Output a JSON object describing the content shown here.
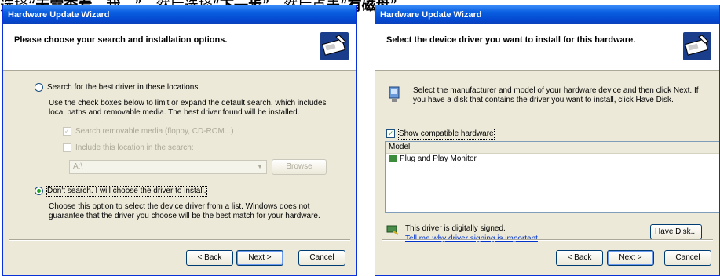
{
  "caption": {
    "pre": "选择“",
    "bold1": "无需查看。我…",
    "mid1": "”，然后选择“",
    "next": "下一步",
    "mid2": "”，然后点击“",
    "bold2": "有磁盘",
    "post": "”。"
  },
  "left_window": {
    "title": "Hardware Update Wizard",
    "header_title": "Please choose your search and installation options.",
    "radio_search_label": "Search for the best driver in these locations.",
    "search_desc": "Use the check boxes below to limit or expand the default search, which includes local paths and removable media. The best driver found will be installed.",
    "check_removable": "Search removable media (floppy, CD-ROM...)",
    "check_location": "Include this location in the search:",
    "location_value": "A:\\",
    "browse_label": "Browse",
    "radio_dont_label": "Don't search. I will choose the driver to install.",
    "dont_desc": "Choose this option to select the device driver from a list. Windows does not guarantee that the driver you choose will be the best match for your hardware.",
    "back_label": "< Back",
    "next_label": "Next >",
    "cancel_label": "Cancel"
  },
  "right_window": {
    "title": "Hardware Update Wizard",
    "header_title": "Select the device driver you want to install for this hardware.",
    "intro_text": "Select the manufacturer and model of your hardware device and then click Next. If you have a disk that contains the driver you want to install, click Have Disk.",
    "show_compatible": "Show compatible hardware",
    "list_header": "Model",
    "list_items": [
      "Plug and Play Monitor"
    ],
    "signed_text": "This driver is digitally signed.",
    "signing_link": "Tell me why driver signing is important",
    "have_disk_label": "Have Disk...",
    "back_label": "< Back",
    "next_label": "Next >",
    "cancel_label": "Cancel"
  }
}
